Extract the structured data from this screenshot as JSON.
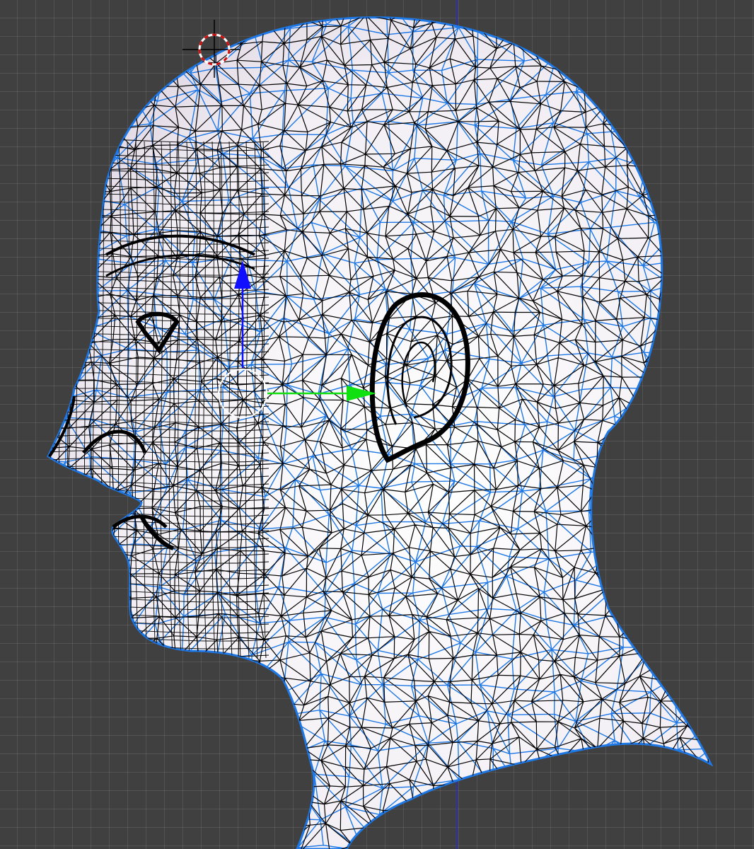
{
  "viewport": {
    "background_color": "#404040",
    "grid_color": "#5a5a5a",
    "view_axis_color": "#2a2ad0"
  },
  "mesh": {
    "surface_color": "#ece6ee",
    "wire_front_color": "#000000",
    "wire_back_color": "#1e78e6"
  },
  "manipulator": {
    "z_axis_color": "#1010ff",
    "y_axis_color": "#10e010",
    "center_color": "#ffffff"
  },
  "cursor_3d": {
    "ring_colors": [
      "#ffffff",
      "#d01010"
    ],
    "crosshair_color": "#000000"
  },
  "icons": [
    "3d-cursor-icon",
    "z-axis-arrow-icon",
    "y-axis-arrow-icon"
  ]
}
